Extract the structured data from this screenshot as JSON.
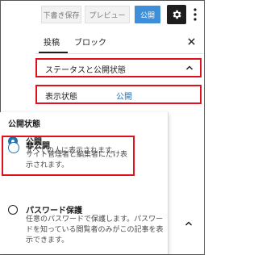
{
  "toolbar": {
    "save_draft_label": "下書き保存",
    "preview_label": "プレビュー",
    "publish_label": "公開"
  },
  "sidebar": {
    "tabs": [
      {
        "label": "投稿",
        "active": true
      },
      {
        "label": "ブロック",
        "active": false
      }
    ],
    "status_section": {
      "title": "ステータスと公開状態",
      "expanded": true
    },
    "visibility_row": {
      "label": "表示状態",
      "value": "公開"
    }
  },
  "popover": {
    "title": "公開状態",
    "options": [
      {
        "label": "公開",
        "description": "すべての人に表示されます。",
        "selected": true
      },
      {
        "label": "非公開",
        "description": "サイト管理者と編集者にだけ表示されます。",
        "selected": false
      },
      {
        "label": "パスワード保護",
        "description": "任意のパスワードで保護します。パスワードを知っている閲覧者のみがこの記事を表示できます。",
        "selected": false
      }
    ]
  },
  "colors": {
    "accent": "#2271b1",
    "publish_button": "#3c8fd8",
    "highlight_box": "#e0101c"
  }
}
